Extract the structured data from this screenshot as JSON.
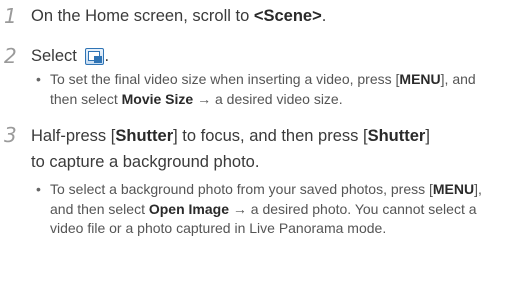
{
  "steps": [
    {
      "number": "1",
      "text_before": "On the Home screen, scroll to ",
      "bold": "<Scene>",
      "text_after": "."
    },
    {
      "number": "2",
      "text_before": "Select ",
      "icon": "scene-photo-icon",
      "text_after": ".",
      "bullet": {
        "part1": "To set the final video size when inserting a video, press [",
        "bold1": "MENU",
        "part2": "], and then select ",
        "bold2": "Movie Size",
        "part3": " → a desired video size."
      }
    },
    {
      "number": "3",
      "text1": "Half-press [",
      "bold1": "Shutter",
      "text2": "] to focus, and then press [",
      "bold2": "Shutter",
      "text3": "]",
      "text4": "to capture a background photo.",
      "bullet": {
        "part1": "To select a background photo from your saved photos, press [",
        "bold1": "MENU",
        "part2": "], and then select ",
        "bold2": "Open Image",
        "part3": " → a desired photo. You cannot select a video file or a photo captured in Live Panorama mode."
      }
    }
  ],
  "colors": {
    "step_number": "#9a9a9a",
    "icon_accent": "#2f74b5"
  }
}
